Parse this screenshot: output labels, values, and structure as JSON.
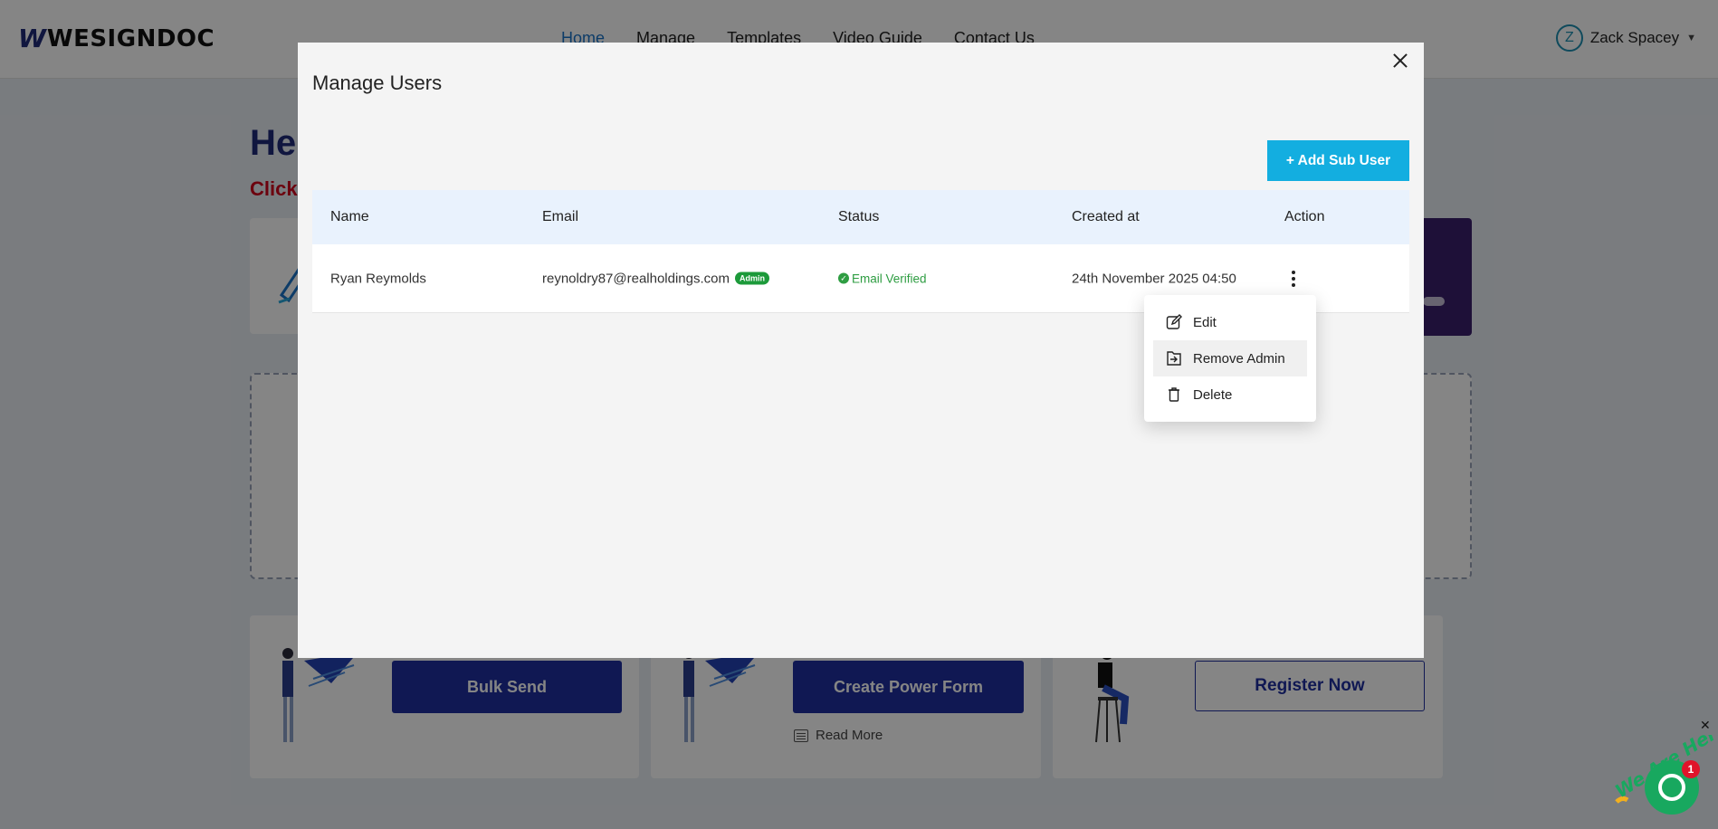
{
  "app": {
    "logo_mark": "W",
    "logo_text": "WESIGNDOC"
  },
  "nav": {
    "items": [
      "Home",
      "Manage",
      "Templates",
      "Video Guide",
      "Contact Us"
    ],
    "active": "Home"
  },
  "user": {
    "initial": "Z",
    "name": "Zack Spacey"
  },
  "background": {
    "hero_title": "He",
    "hero_sub": "Click",
    "cards": {
      "bulk_send": "Bulk Send",
      "power_form": "Create Power Form",
      "read_more": "Read More",
      "register": "Register Now"
    }
  },
  "modal": {
    "title": "Manage Users",
    "add_button": "+ Add Sub User",
    "columns": [
      "Name",
      "Email",
      "Status",
      "Created at",
      "Action"
    ],
    "rows": [
      {
        "name": "Ryan Reymolds",
        "email": "reynoldry87@realholdings.com",
        "badge": "Admin",
        "status": "Email Verified",
        "created_at": "24th November 2025 04:50"
      }
    ],
    "action_menu": [
      "Edit",
      "Remove Admin",
      "Delete"
    ]
  },
  "chat": {
    "banner": "We Are Here!",
    "unread": "1"
  },
  "colors": {
    "accent": "#13aee0",
    "brand": "#1f2fa0",
    "verified": "#2e9d42",
    "admin_badge": "#1c9a3a"
  }
}
